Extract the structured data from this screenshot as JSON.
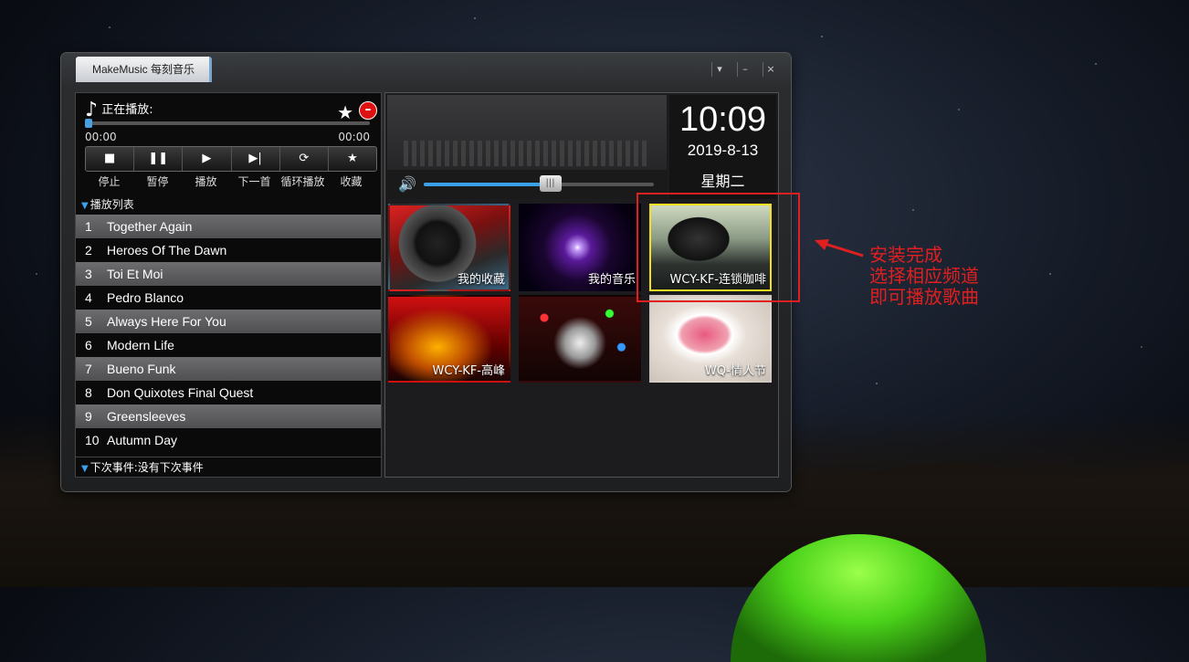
{
  "app": {
    "logo_text": "MakeMusic 每刻音乐",
    "window_controls": [
      "▾",
      "–",
      "×"
    ]
  },
  "player": {
    "now_playing_label": "正在播放:",
    "progress": 0.0,
    "time_elapsed": "00:00",
    "time_total": "00:00",
    "controls": [
      {
        "icon": "stop-icon",
        "glyph": "■",
        "label": "停止"
      },
      {
        "icon": "pause-icon",
        "glyph": "❚❚",
        "label": "暂停"
      },
      {
        "icon": "play-icon",
        "glyph": "▶",
        "label": "播放"
      },
      {
        "icon": "next-icon",
        "glyph": "▶|",
        "label": "下一首"
      },
      {
        "icon": "loop-icon",
        "glyph": "⟳",
        "label": "循环播放"
      },
      {
        "icon": "star-icon",
        "glyph": "★",
        "label": "收藏"
      }
    ]
  },
  "playlist": {
    "header": "播放列表",
    "items": [
      {
        "num": "1",
        "title": "Together Again"
      },
      {
        "num": "2",
        "title": "Heroes Of The Dawn"
      },
      {
        "num": "3",
        "title": "Toi Et Moi"
      },
      {
        "num": "4",
        "title": "Pedro Blanco"
      },
      {
        "num": "5",
        "title": "Always Here For You"
      },
      {
        "num": "6",
        "title": "Modern Life"
      },
      {
        "num": "7",
        "title": "Bueno Funk"
      },
      {
        "num": "8",
        "title": "Don Quixotes Final Quest"
      },
      {
        "num": "9",
        "title": "Greensleeves"
      },
      {
        "num": "10",
        "title": "Autumn Day"
      }
    ],
    "next_event": "下次事件:没有下次事件"
  },
  "volume": {
    "level": 0.55
  },
  "clock": {
    "time": "10:09",
    "date": "2019-8-13",
    "weekday": "星期二"
  },
  "channels": [
    {
      "label": "我的收藏",
      "selected": false
    },
    {
      "label": "我的音乐",
      "selected": false
    },
    {
      "label": "WCY-KF-连锁咖啡",
      "selected": true
    },
    {
      "label": "WCY-KF-高峰",
      "selected": false
    },
    {
      "label": "",
      "selected": false
    },
    {
      "label": "WQ-情人节",
      "selected": false
    }
  ],
  "annotation": {
    "lines": [
      "安装完成",
      "选择相应频道",
      "即可播放歌曲"
    ],
    "color": "#e02020"
  }
}
